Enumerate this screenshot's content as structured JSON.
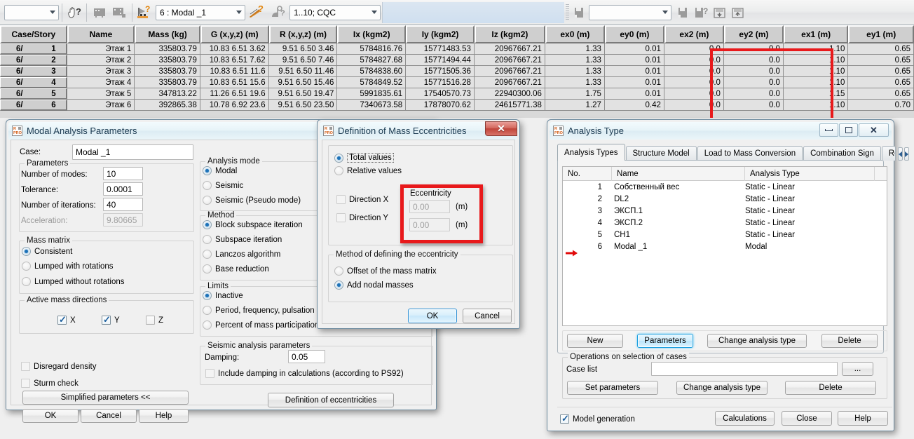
{
  "toolbar": {
    "left_combo_value": "",
    "case_combo_value": "6 : Modal _1",
    "cqc_combo_value": "1..10; CQC",
    "right_combo_value": "",
    "icons": [
      "hand-question-icon",
      "panel-icon",
      "panel-dots-icon",
      "structure-question-icon",
      "surface-question-icon",
      "load-question-icon",
      "save-icon",
      "help-question-icon",
      "calc-down-icon",
      "calc-up-icon"
    ]
  },
  "table": {
    "columns": [
      "Case/Story",
      "Name",
      "Mass (kg)",
      "G (x,y,z) (m)",
      "R (x,y,z) (m)",
      "Ix (kgm2)",
      "Iy (kgm2)",
      "Iz (kgm2)",
      "ex0 (m)",
      "ey0 (m)",
      "ex2 (m)",
      "ey2 (m)",
      "ex1 (m)",
      "ey1 (m)"
    ],
    "rows": [
      {
        "case": "6/",
        "story": "1",
        "name": "Этаж 1",
        "mass": "335803.79",
        "g": "10.83 6.51 3.62",
        "r": "9.51 6.50 3.46",
        "ix": "5784816.76",
        "iy": "15771483.53",
        "iz": "20967667.21",
        "ex0": "1.33",
        "ey0": "0.01",
        "ex2": "0.0",
        "ey2": "0.0",
        "ex1": "1.10",
        "ey1": "0.65"
      },
      {
        "case": "6/",
        "story": "2",
        "name": "Этаж 2",
        "mass": "335803.79",
        "g": "10.83 6.51 7.62",
        "r": "9.51 6.50 7.46",
        "ix": "5784827.68",
        "iy": "15771494.44",
        "iz": "20967667.21",
        "ex0": "1.33",
        "ey0": "0.01",
        "ex2": "0.0",
        "ey2": "0.0",
        "ex1": "1.10",
        "ey1": "0.65"
      },
      {
        "case": "6/",
        "story": "3",
        "name": "Этаж 3",
        "mass": "335803.79",
        "g": "10.83 6.51 11.6",
        "r": "9.51 6.50 11.46",
        "ix": "5784838.60",
        "iy": "15771505.36",
        "iz": "20967667.21",
        "ex0": "1.33",
        "ey0": "0.01",
        "ex2": "0.0",
        "ey2": "0.0",
        "ex1": "1.10",
        "ey1": "0.65"
      },
      {
        "case": "6/",
        "story": "4",
        "name": "Этаж 4",
        "mass": "335803.79",
        "g": "10.83 6.51 15.6",
        "r": "9.51 6.50 15.46",
        "ix": "5784849.52",
        "iy": "15771516.28",
        "iz": "20967667.21",
        "ex0": "1.33",
        "ey0": "0.01",
        "ex2": "0.0",
        "ey2": "0.0",
        "ex1": "1.10",
        "ey1": "0.65"
      },
      {
        "case": "6/",
        "story": "5",
        "name": "Этаж 5",
        "mass": "347813.22",
        "g": "11.26 6.51 19.6",
        "r": "9.51 6.50 19.47",
        "ix": "5991835.61",
        "iy": "17540570.73",
        "iz": "22940300.06",
        "ex0": "1.75",
        "ey0": "0.01",
        "ex2": "0.0",
        "ey2": "0.0",
        "ex1": "1.15",
        "ey1": "0.65"
      },
      {
        "case": "6/",
        "story": "6",
        "name": "Этаж 6",
        "mass": "392865.38",
        "g": "10.78 6.92 23.6",
        "r": "9.51 6.50 23.50",
        "ix": "7340673.58",
        "iy": "17878070.62",
        "iz": "24615771.38",
        "ex0": "1.27",
        "ey0": "0.42",
        "ex2": "0.0",
        "ey2": "0.0",
        "ex1": "1.10",
        "ey1": "0.70"
      }
    ],
    "highlight_color": "#e8191b"
  },
  "modal_dialog": {
    "title": "Modal Analysis Parameters",
    "case_label": "Case:",
    "case_value": "Modal _1",
    "parameters_group": "Parameters",
    "number_of_modes_label": "Number of modes:",
    "number_of_modes_value": "10",
    "tolerance_label": "Tolerance:",
    "tolerance_value": "0.0001",
    "number_of_iterations_label": "Number of iterations:",
    "number_of_iterations_value": "40",
    "acceleration_label": "Acceleration:",
    "acceleration_value": "9.80665",
    "mass_matrix_group": "Mass matrix",
    "mass_matrix_options": [
      "Consistent",
      "Lumped with rotations",
      "Lumped without rotations"
    ],
    "mass_matrix_selected": 0,
    "active_mass_group": "Active mass directions",
    "dir_x": "X",
    "dir_y": "Y",
    "dir_z": "Z",
    "dir_x_checked": true,
    "dir_y_checked": true,
    "dir_z_checked": false,
    "disregard_density": "Disregard density",
    "sturm_check": "Sturm check",
    "simplified_parameters": "Simplified parameters <<",
    "ok": "OK",
    "cancel": "Cancel",
    "help": "Help",
    "analysis_mode_group": "Analysis mode",
    "analysis_mode_options": [
      "Modal",
      "Seismic",
      "Seismic (Pseudo mode)"
    ],
    "analysis_mode_selected": 0,
    "method_group": "Method",
    "method_options": [
      "Block subspace iteration",
      "Subspace iteration",
      "Lanczos algorithm",
      "Base reduction"
    ],
    "method_selected": 0,
    "limits_group": "Limits",
    "limits_options": [
      "Inactive",
      "Period, frequency, pulsation",
      "Percent of mass participation"
    ],
    "limits_selected": 0,
    "seismic_group": "Seismic analysis parameters",
    "damping_label": "Damping:",
    "damping_value": "0.05",
    "include_damping": "Include damping in calculations (according to PS92)",
    "definition_of_eccentricities": "Definition of eccentricities"
  },
  "ecc_dialog": {
    "title": "Definition of Mass Eccentricities",
    "close_glyph": "✕",
    "total_values": "Total values",
    "relative_values": "Relative values",
    "values_selected": 0,
    "direction_x": "Direction X",
    "direction_y": "Direction Y",
    "direction_x_checked": false,
    "direction_y_checked": false,
    "eccentricity_label": "Eccentricity",
    "ecc_x_value": "0.00",
    "ecc_y_value": "0.00",
    "unit": "(m)",
    "method_group": "Method of defining the eccentricity",
    "method_options": [
      "Offset of the mass matrix",
      "Add nodal masses"
    ],
    "method_selected": 1,
    "ok": "OK",
    "cancel": "Cancel",
    "highlight_color": "#e8191b"
  },
  "analysis_type_dialog": {
    "title": "Analysis Type",
    "tabs": [
      "Analysis Types",
      "Structure Model",
      "Load to Mass Conversion",
      "Combination Sign",
      "Result F"
    ],
    "selected_tab": 0,
    "list_headers": [
      "No.",
      "Name",
      "Analysis Type"
    ],
    "rows": [
      {
        "no": "1",
        "name": "Собственный вес",
        "type": "Static - Linear",
        "marked": false
      },
      {
        "no": "2",
        "name": "DL2",
        "type": "Static - Linear",
        "marked": false
      },
      {
        "no": "3",
        "name": "ЭКСП.1",
        "type": "Static - Linear",
        "marked": false
      },
      {
        "no": "4",
        "name": "ЭКСП.2",
        "type": "Static - Linear",
        "marked": false
      },
      {
        "no": "5",
        "name": "CH1",
        "type": "Static - Linear",
        "marked": false
      },
      {
        "no": "6",
        "name": "Modal _1",
        "type": "Modal",
        "marked": true
      }
    ],
    "new_btn": "New",
    "parameters_btn": "Parameters",
    "change_analysis_type_btn": "Change analysis type",
    "delete_btn": "Delete",
    "operations_group": "Operations on selection of cases",
    "case_list_label": "Case list",
    "case_list_value": "",
    "browse_btn": "...",
    "set_parameters_btn": "Set parameters",
    "change_analysis_type_btn2": "Change analysis type",
    "delete_btn2": "Delete",
    "model_generation": "Model generation",
    "model_generation_checked": true,
    "calculations_btn": "Calculations",
    "close_btn": "Close",
    "help_btn": "Help"
  }
}
